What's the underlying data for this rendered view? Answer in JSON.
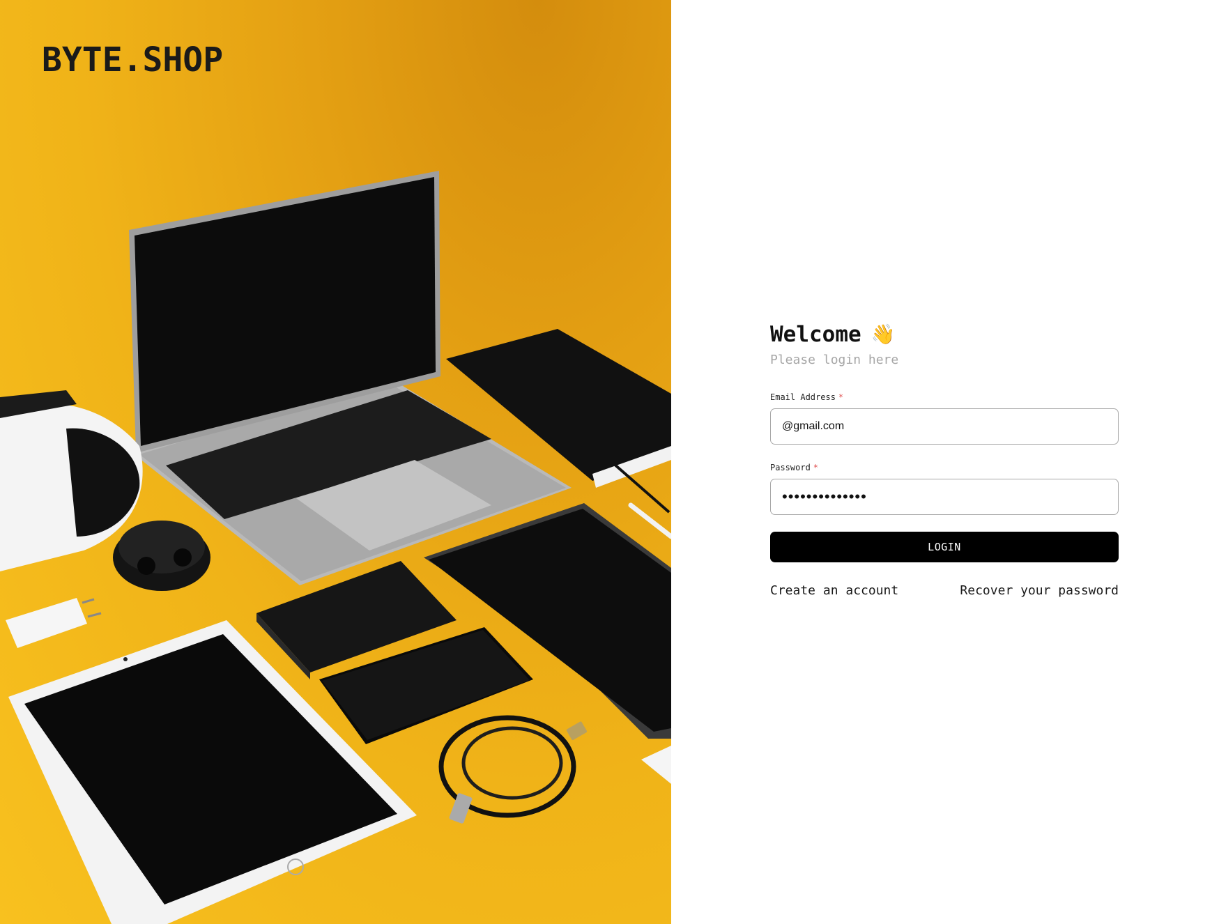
{
  "brand": {
    "name": "BYTE.SHOP"
  },
  "hero": {
    "image": "electronics-flatlay-on-yellow-background"
  },
  "login": {
    "title": "Welcome",
    "title_emoji": "👋",
    "subtitle": "Please login here",
    "email_label": "Email Address",
    "email_value": "@gmail.com",
    "password_label": "Password",
    "password_mask": "••••••••••••••",
    "required_marker": "*",
    "login_button": "LOGIN",
    "create_account": "Create an account",
    "recover_password": "Recover your password"
  },
  "colors": {
    "hero_yellow": "#f5b81c",
    "button_black": "#000000",
    "required_red": "#e05252",
    "subtitle_gray": "#a6a6a6"
  }
}
